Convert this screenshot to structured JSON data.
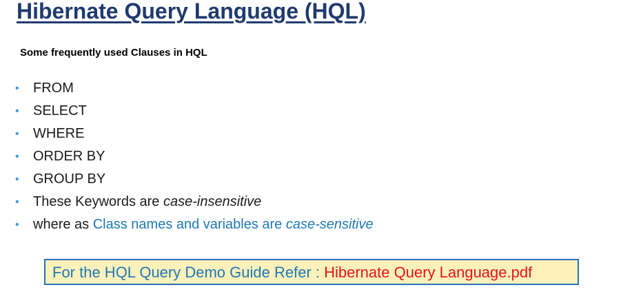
{
  "title": "Hibernate Query Language (HQL)",
  "subtitle": "Some frequently used Clauses in HQL",
  "bullets": {
    "from": "FROM",
    "select": "SELECT",
    "where": "WHERE",
    "order_by": "ORDER BY",
    "group_by": "GROUP BY",
    "keywords_prefix": "These Keywords are ",
    "keywords_em": "case-insensitive",
    "classnames_prefix": "where as ",
    "classnames_blue": "Class names and variables are ",
    "classnames_em": "case-sensitive"
  },
  "reference": {
    "label": "For the HQL Query Demo Guide Refer : ",
    "link": "Hibernate Query Language.pdf"
  },
  "colors": {
    "title": "#1f3a6e",
    "bullet": "#3a9ad9",
    "blue_text": "#1e78b4",
    "link": "#e8141c",
    "box_fill": "#fdf1bb",
    "box_border": "#2d6fb3"
  }
}
